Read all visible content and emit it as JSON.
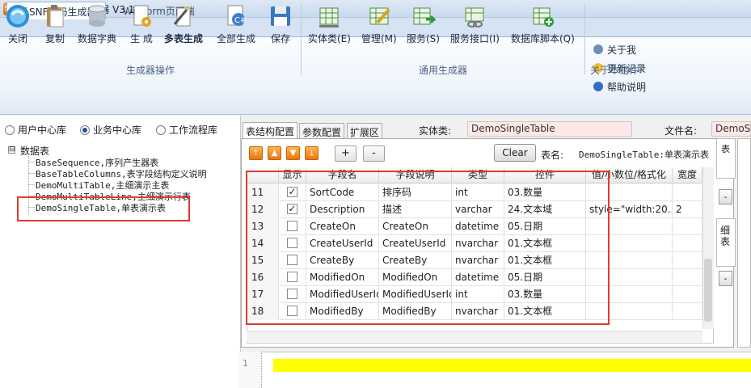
{
  "window": {
    "title": "SNF 代码批量生成器 V3.1",
    "app_icon_text": "SN"
  },
  "ribbon_tabs": [
    {
      "label": "SNF代码生成器",
      "active": true
    },
    {
      "label": "WinForm页面端",
      "active": false
    }
  ],
  "ribbon": {
    "group_generator": {
      "label": "生成器操作",
      "buttons": [
        "关闭",
        "复制",
        "数据字典",
        "生 成",
        "多表生成",
        "全部生成",
        "保存"
      ]
    },
    "group_general": {
      "label": "通用生成器",
      "buttons": [
        "实体类(E)",
        "管理(M)",
        "服务(S)",
        "服务接口(I)",
        "数据库脚本(Q)"
      ]
    },
    "group_about": {
      "label": "关于本组件",
      "buttons": [
        "关于我",
        "更新记录",
        "帮助说明"
      ]
    }
  },
  "db_radios": {
    "options": [
      "用户中心库",
      "业务中心库",
      "工作流程库"
    ],
    "selected": "业务中心库"
  },
  "tree": {
    "toggle": "⊟",
    "root": "数据表",
    "items": [
      "BaseSequence,序列产生器表",
      "BaseTableColumns,表字段结构定义说明",
      "DemoMultiTable,主细演示主表",
      "DemoMultiTableLine,主细演示行表",
      "DemoSingleTable,单表演示表"
    ]
  },
  "panel_tabs": [
    "表结构配置",
    "参数配置",
    "扩展区"
  ],
  "entity": {
    "label": "实体类:",
    "value": "DemoSingleTable"
  },
  "file": {
    "label": "文件名:",
    "value": "DemoSingleTable"
  },
  "toolbar": {
    "plus": "+",
    "minus": "-",
    "clear": "Clear",
    "table_label": "表名:",
    "table_value": "DemoSingleTable:单表演示表"
  },
  "grid": {
    "columns": [
      "显示",
      "字段名",
      "字段说明",
      "类型",
      "控件",
      "值/小数位/格式化",
      "宽度"
    ],
    "rows": [
      {
        "num": "11",
        "checked": true,
        "field": "SortCode",
        "desc": "排序码",
        "type": "int",
        "control": "03.数量",
        "format": "",
        "width": ""
      },
      {
        "num": "12",
        "checked": true,
        "field": "Description",
        "desc": "描述",
        "type": "varchar",
        "control": "24.文本域",
        "format": "style=\"width:20...",
        "width": "2"
      },
      {
        "num": "13",
        "checked": false,
        "field": "CreateOn",
        "desc": "CreateOn",
        "type": "datetime",
        "control": "05.日期",
        "format": "",
        "width": ""
      },
      {
        "num": "14",
        "checked": false,
        "field": "CreateUserId",
        "desc": "CreateUserId",
        "type": "nvarchar",
        "control": "01.文本框",
        "format": "",
        "width": ""
      },
      {
        "num": "15",
        "checked": false,
        "field": "CreateBy",
        "desc": "CreateBy",
        "type": "nvarchar",
        "control": "01.文本框",
        "format": "",
        "width": ""
      },
      {
        "num": "16",
        "checked": false,
        "field": "ModifiedOn",
        "desc": "ModifiedOn",
        "type": "datetime",
        "control": "05.日期",
        "format": "",
        "width": ""
      },
      {
        "num": "17",
        "checked": false,
        "field": "ModifiedUserId",
        "desc": "ModifiedUserId",
        "type": "int",
        "control": "03.数量",
        "format": "",
        "width": ""
      },
      {
        "num": "18",
        "checked": false,
        "field": "ModifiedBy",
        "desc": "ModifiedBy",
        "type": "nvarchar",
        "control": "01.文本框",
        "format": "",
        "width": ""
      }
    ]
  },
  "side_strip": {
    "label_top": "表",
    "label_detail": "细表",
    "minus": "-"
  },
  "editor": {
    "line_number": "1"
  },
  "colors": {
    "highlight_box": "#e03a2f",
    "editor_highlight": "#ffff00",
    "entity_field_bg": "#fde7e7"
  }
}
